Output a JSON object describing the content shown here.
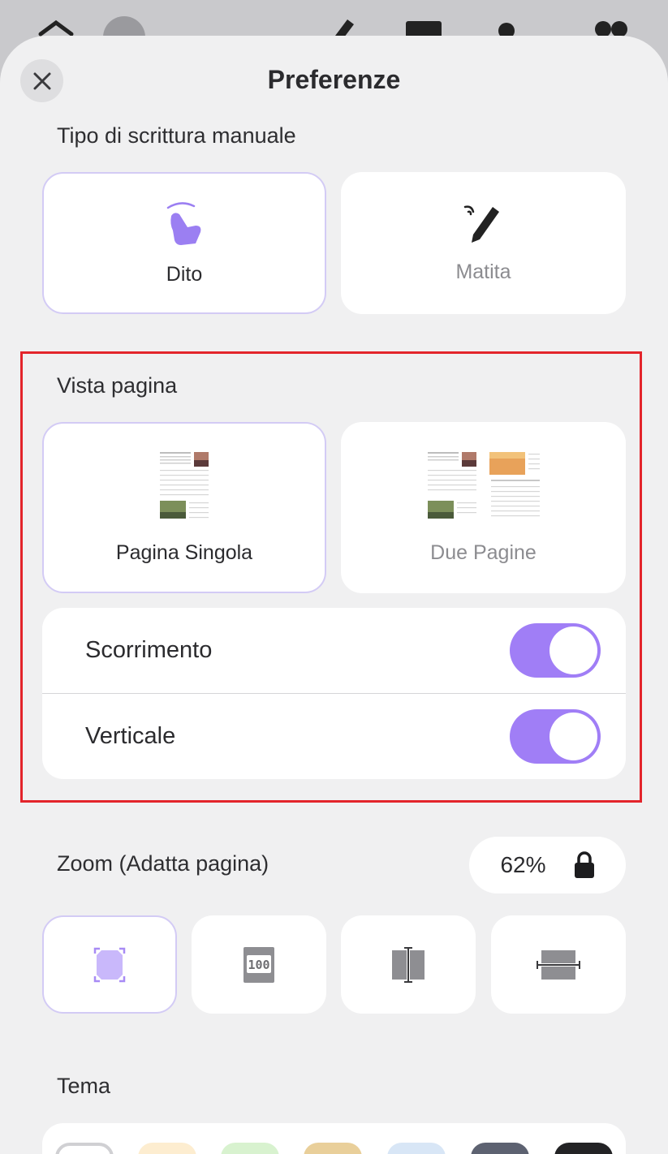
{
  "header": {
    "title": "Preferenze"
  },
  "handwriting": {
    "label": "Tipo di scrittura manuale",
    "options": [
      {
        "label": "Dito",
        "selected": true,
        "icon": "finger-touch-icon"
      },
      {
        "label": "Matita",
        "selected": false,
        "icon": "pencil-icon"
      }
    ]
  },
  "page_view": {
    "label": "Vista pagina",
    "options": [
      {
        "label": "Pagina Singola",
        "selected": true,
        "icon": "single-page-preview"
      },
      {
        "label": "Due Pagine",
        "selected": false,
        "icon": "two-page-preview"
      }
    ],
    "toggles": [
      {
        "label": "Scorrimento",
        "on": true
      },
      {
        "label": "Verticale",
        "on": true
      }
    ]
  },
  "zoom": {
    "label": "Zoom (Adatta pagina)",
    "value": "62%",
    "locked": true,
    "modes": [
      {
        "name": "fit-page",
        "icon": "fit-page-icon",
        "selected": true
      },
      {
        "name": "actual-size",
        "icon": "actual-size-100-icon",
        "selected": false
      },
      {
        "name": "fit-width",
        "icon": "fit-width-icon",
        "selected": false
      },
      {
        "name": "fit-height",
        "icon": "fit-height-icon",
        "selected": false
      }
    ]
  },
  "theme": {
    "label": "Tema",
    "swatches": [
      "#ffffff",
      "#fdedd0",
      "#d8f2cf",
      "#e9cf9a",
      "#d8e6f6",
      "#5d6271",
      "#232325"
    ]
  },
  "colors": {
    "accent": "#a07ef6",
    "selected_border": "#d3cbf5",
    "highlight": "#e3242b"
  }
}
